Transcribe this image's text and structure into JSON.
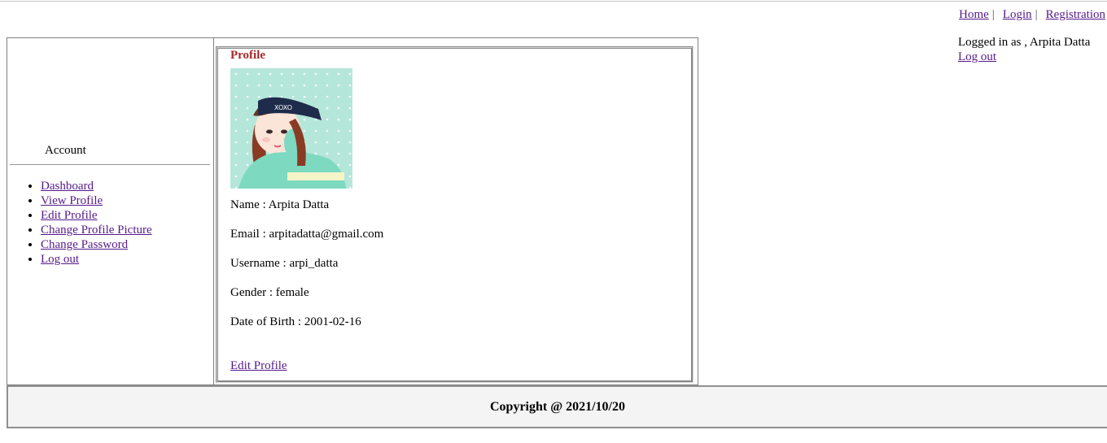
{
  "topnav": {
    "home": "Home",
    "login": "Login",
    "registration": "Registration",
    "separator": "|"
  },
  "userbox": {
    "logged_in_text": "Logged in as , Arpita Datta",
    "logout": "Log out"
  },
  "sidebar": {
    "title": "Account",
    "items": [
      {
        "label": "Dashboard"
      },
      {
        "label": "View Profile"
      },
      {
        "label": "Edit Profile"
      },
      {
        "label": "Change Profile Picture"
      },
      {
        "label": "Change Password"
      },
      {
        "label": "Log out"
      }
    ]
  },
  "profile": {
    "legend": "Profile",
    "avatar_icon": "profile-picture",
    "name": "Name : Arpita Datta",
    "email": "Email : arpitadatta@gmail.com",
    "username": "Username : arpi_datta",
    "gender": "Gender : female",
    "dob": "Date of Birth : 2001-02-16",
    "edit_link": "Edit Profile"
  },
  "footer": {
    "copyright": "Copyright @ 2021/10/20"
  },
  "colors": {
    "link": "#551a8b",
    "legend": "#a52a2a",
    "footer_bg": "#f4f4f4"
  }
}
